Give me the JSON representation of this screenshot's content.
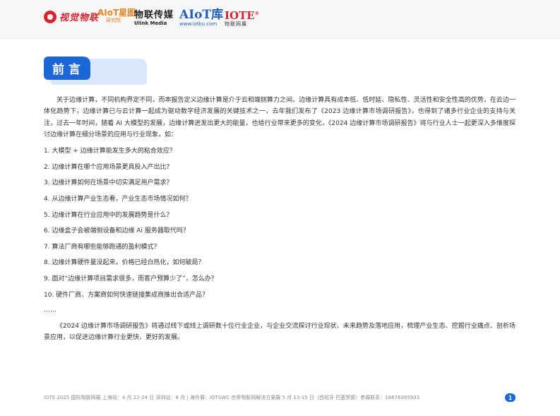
{
  "header": {
    "logos": {
      "shijue": "视觉物联",
      "aiot_research_top": "AIoT星图",
      "aiot_research_bottom": "研究院",
      "wulian_chuanmei": "物联传媒",
      "ulink_media": "Ulink Media",
      "aiot_ku": "AIoT库",
      "aiot_ku_url": "www.iotku.com",
      "iote": "IOTE",
      "iote_reg": "®",
      "iote_sub": "物联网展"
    }
  },
  "section": {
    "title": "前言"
  },
  "intro": "关于边缘计算，不同机构界定不同，而本报告定义边缘计算是介于云和端侧算力之间。边缘计算具有成本低、低时延、隐私性、灵活性和安全性高的优势，在云边一体化趋势下，边缘计算已与云计算一起成为驱动数字经济发展的关键技术之一，去年我们发布了《2023 边缘计算市场调研报告》，也得到了诸多行业企业的支持与关注，过去一年时间，随着 AI 大模型的发展，边缘计算迸发出更大的能量，也给行业带来更多的变化，《2024 边缘计算市场调研报告》将与行业人士一起更深入多维度探讨边缘计算在细分场景的应用与行业现象，如：",
  "questions": [
    "1. 大模型 + 边缘计算能发生多大的粘合效应？",
    "2. 边缘计算在哪个应用场景更具投入产出比？",
    "3. 边缘计算如何在场景中切实满足用户需求？",
    "4. 从边缘计算产业生态看，产业生态市场情况如何？",
    "5. 边缘计算在行业应用中的发展趋势是什么？",
    "6. 边缘盒子会被端侧设备和边缘 Ai 服务器取代吗？",
    "7. 算法厂商有哪些能够跑通的盈利模式？",
    "8. 边缘计算硬件量没起来，价格已经白热化，如何破局？",
    "9. 面对“边缘计算项目需求很多，而客户预算少了”，怎么办？",
    "10. 硬件厂商、方案商如何快速链接集成商推出合适产品？"
  ],
  "ellipsis": "……",
  "closing": "《2024 边缘计算市场调研报告》将通过线下或线上调研数十位行业企业，与企业交流探讨行业现状、未来趋势及落地应用，梳理产业生态、挖掘行业痛点、剖析场景应用，以促进边缘计算行业更快、更好的发展。",
  "footer": {
    "text": "IOTE 2025 国际物联网展 上海站：4 月 22-24 日 深圳站：8 月 | 海外展：IOTSWC 世界物联网解决方案展 5 月 13-15 日（西班牙·巴塞罗那）参展联系：18676385933",
    "page": "1"
  },
  "colors": {
    "accent": "#1b67d8",
    "accent_light": "#d9e8fb",
    "brand_red": "#d7262e"
  }
}
